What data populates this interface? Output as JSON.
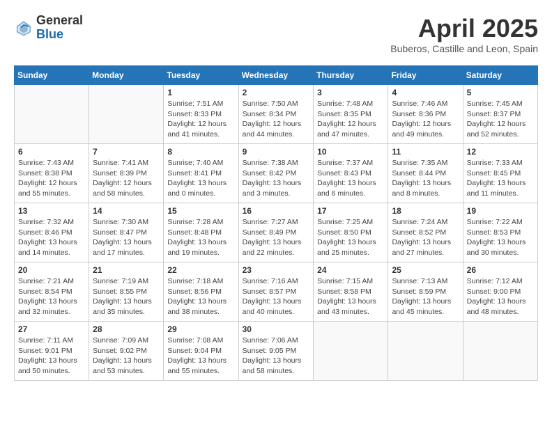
{
  "header": {
    "logo_general": "General",
    "logo_blue": "Blue",
    "title": "April 2025",
    "subtitle": "Buberos, Castille and Leon, Spain"
  },
  "weekdays": [
    "Sunday",
    "Monday",
    "Tuesday",
    "Wednesday",
    "Thursday",
    "Friday",
    "Saturday"
  ],
  "weeks": [
    [
      {
        "day": "",
        "info": ""
      },
      {
        "day": "",
        "info": ""
      },
      {
        "day": "1",
        "info": "Sunrise: 7:51 AM\nSunset: 8:33 PM\nDaylight: 12 hours and 41 minutes."
      },
      {
        "day": "2",
        "info": "Sunrise: 7:50 AM\nSunset: 8:34 PM\nDaylight: 12 hours and 44 minutes."
      },
      {
        "day": "3",
        "info": "Sunrise: 7:48 AM\nSunset: 8:35 PM\nDaylight: 12 hours and 47 minutes."
      },
      {
        "day": "4",
        "info": "Sunrise: 7:46 AM\nSunset: 8:36 PM\nDaylight: 12 hours and 49 minutes."
      },
      {
        "day": "5",
        "info": "Sunrise: 7:45 AM\nSunset: 8:37 PM\nDaylight: 12 hours and 52 minutes."
      }
    ],
    [
      {
        "day": "6",
        "info": "Sunrise: 7:43 AM\nSunset: 8:38 PM\nDaylight: 12 hours and 55 minutes."
      },
      {
        "day": "7",
        "info": "Sunrise: 7:41 AM\nSunset: 8:39 PM\nDaylight: 12 hours and 58 minutes."
      },
      {
        "day": "8",
        "info": "Sunrise: 7:40 AM\nSunset: 8:41 PM\nDaylight: 13 hours and 0 minutes."
      },
      {
        "day": "9",
        "info": "Sunrise: 7:38 AM\nSunset: 8:42 PM\nDaylight: 13 hours and 3 minutes."
      },
      {
        "day": "10",
        "info": "Sunrise: 7:37 AM\nSunset: 8:43 PM\nDaylight: 13 hours and 6 minutes."
      },
      {
        "day": "11",
        "info": "Sunrise: 7:35 AM\nSunset: 8:44 PM\nDaylight: 13 hours and 8 minutes."
      },
      {
        "day": "12",
        "info": "Sunrise: 7:33 AM\nSunset: 8:45 PM\nDaylight: 13 hours and 11 minutes."
      }
    ],
    [
      {
        "day": "13",
        "info": "Sunrise: 7:32 AM\nSunset: 8:46 PM\nDaylight: 13 hours and 14 minutes."
      },
      {
        "day": "14",
        "info": "Sunrise: 7:30 AM\nSunset: 8:47 PM\nDaylight: 13 hours and 17 minutes."
      },
      {
        "day": "15",
        "info": "Sunrise: 7:28 AM\nSunset: 8:48 PM\nDaylight: 13 hours and 19 minutes."
      },
      {
        "day": "16",
        "info": "Sunrise: 7:27 AM\nSunset: 8:49 PM\nDaylight: 13 hours and 22 minutes."
      },
      {
        "day": "17",
        "info": "Sunrise: 7:25 AM\nSunset: 8:50 PM\nDaylight: 13 hours and 25 minutes."
      },
      {
        "day": "18",
        "info": "Sunrise: 7:24 AM\nSunset: 8:52 PM\nDaylight: 13 hours and 27 minutes."
      },
      {
        "day": "19",
        "info": "Sunrise: 7:22 AM\nSunset: 8:53 PM\nDaylight: 13 hours and 30 minutes."
      }
    ],
    [
      {
        "day": "20",
        "info": "Sunrise: 7:21 AM\nSunset: 8:54 PM\nDaylight: 13 hours and 32 minutes."
      },
      {
        "day": "21",
        "info": "Sunrise: 7:19 AM\nSunset: 8:55 PM\nDaylight: 13 hours and 35 minutes."
      },
      {
        "day": "22",
        "info": "Sunrise: 7:18 AM\nSunset: 8:56 PM\nDaylight: 13 hours and 38 minutes."
      },
      {
        "day": "23",
        "info": "Sunrise: 7:16 AM\nSunset: 8:57 PM\nDaylight: 13 hours and 40 minutes."
      },
      {
        "day": "24",
        "info": "Sunrise: 7:15 AM\nSunset: 8:58 PM\nDaylight: 13 hours and 43 minutes."
      },
      {
        "day": "25",
        "info": "Sunrise: 7:13 AM\nSunset: 8:59 PM\nDaylight: 13 hours and 45 minutes."
      },
      {
        "day": "26",
        "info": "Sunrise: 7:12 AM\nSunset: 9:00 PM\nDaylight: 13 hours and 48 minutes."
      }
    ],
    [
      {
        "day": "27",
        "info": "Sunrise: 7:11 AM\nSunset: 9:01 PM\nDaylight: 13 hours and 50 minutes."
      },
      {
        "day": "28",
        "info": "Sunrise: 7:09 AM\nSunset: 9:02 PM\nDaylight: 13 hours and 53 minutes."
      },
      {
        "day": "29",
        "info": "Sunrise: 7:08 AM\nSunset: 9:04 PM\nDaylight: 13 hours and 55 minutes."
      },
      {
        "day": "30",
        "info": "Sunrise: 7:06 AM\nSunset: 9:05 PM\nDaylight: 13 hours and 58 minutes."
      },
      {
        "day": "",
        "info": ""
      },
      {
        "day": "",
        "info": ""
      },
      {
        "day": "",
        "info": ""
      }
    ]
  ]
}
